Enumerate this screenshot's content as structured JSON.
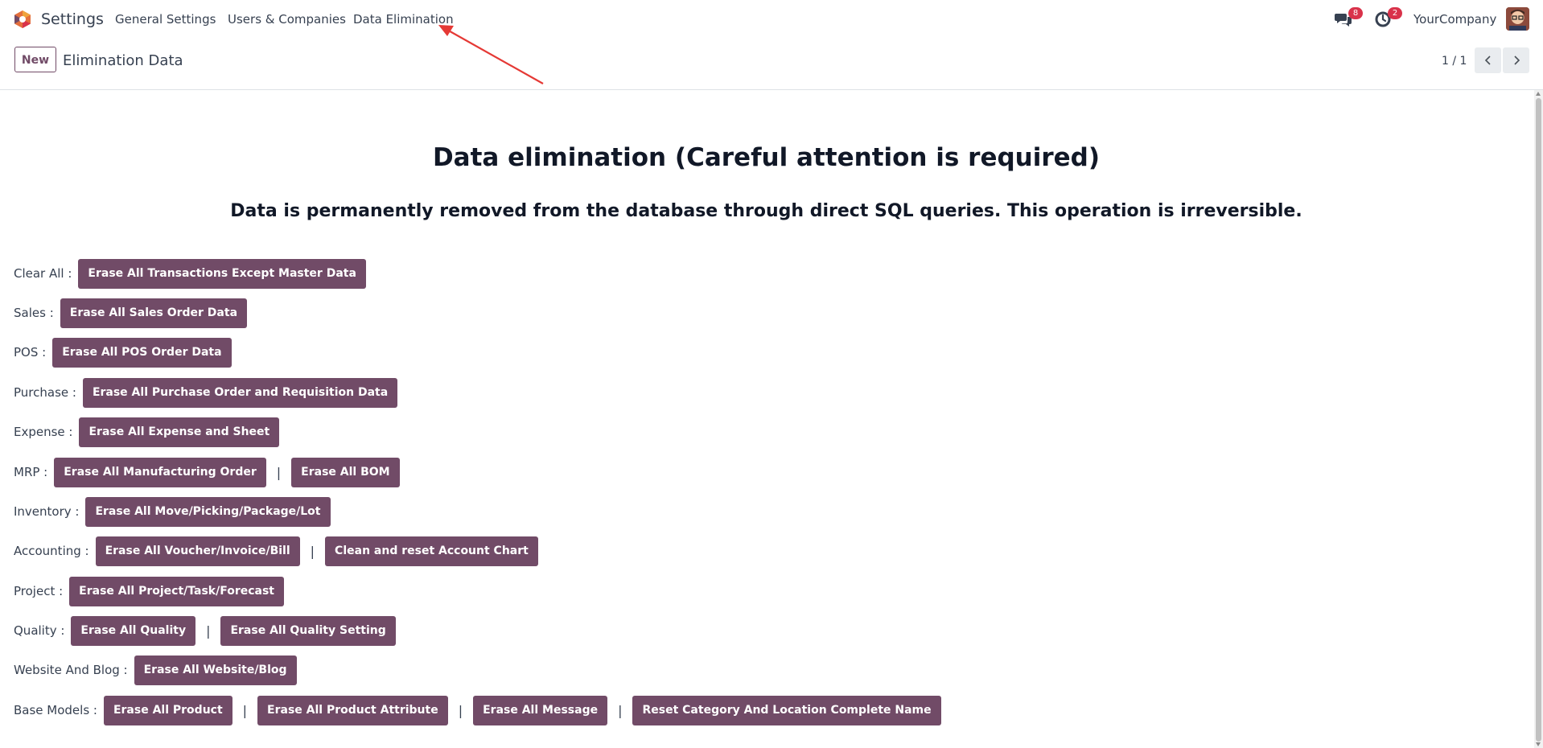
{
  "navbar": {
    "app_name": "Settings",
    "menus": [
      "General Settings",
      "Users & Companies",
      "Data Elimination"
    ],
    "messages_badge": "8",
    "activities_badge": "2",
    "company": "YourCompany"
  },
  "control_panel": {
    "new_label": "New",
    "title": "Elimination Data",
    "pager": "1 / 1"
  },
  "main": {
    "title": "Data elimination (Careful attention is required)",
    "subtitle": "Data is permanently removed from the database through direct SQL queries. This operation is irreversible.",
    "rows": [
      {
        "label": "Clear All :",
        "buttons": [
          "Erase All Transactions Except Master Data"
        ]
      },
      {
        "label": "Sales :",
        "buttons": [
          "Erase All Sales Order Data"
        ]
      },
      {
        "label": "POS :",
        "buttons": [
          "Erase All POS Order Data"
        ]
      },
      {
        "label": "Purchase :",
        "buttons": [
          "Erase All Purchase Order and Requisition Data"
        ]
      },
      {
        "label": "Expense :",
        "buttons": [
          "Erase All Expense and Sheet"
        ]
      },
      {
        "label": "MRP :",
        "buttons": [
          "Erase All Manufacturing Order",
          "Erase All BOM"
        ]
      },
      {
        "label": "Inventory :",
        "buttons": [
          "Erase All Move/Picking/Package/Lot"
        ]
      },
      {
        "label": "Accounting :",
        "buttons": [
          "Erase All Voucher/Invoice/Bill",
          "Clean and reset Account Chart"
        ]
      },
      {
        "label": "Project :",
        "buttons": [
          "Erase All Project/Task/Forecast"
        ]
      },
      {
        "label": "Quality :",
        "buttons": [
          "Erase All Quality",
          "Erase All Quality Setting"
        ]
      },
      {
        "label": "Website And Blog :",
        "buttons": [
          "Erase All Website/Blog"
        ]
      },
      {
        "label": "Base Models :",
        "buttons": [
          "Erase All Product",
          "Erase All Product Attribute",
          "Erase All Message",
          "Reset Category And Location Complete Name"
        ]
      }
    ],
    "separator": "|"
  },
  "colors": {
    "primary": "#714B67",
    "badge": "#d9324a",
    "annotation_arrow": "#e53935"
  },
  "icons": [
    "odoo-logo-icon",
    "chat-icon",
    "clock-icon",
    "chevron-left-icon",
    "chevron-right-icon"
  ]
}
